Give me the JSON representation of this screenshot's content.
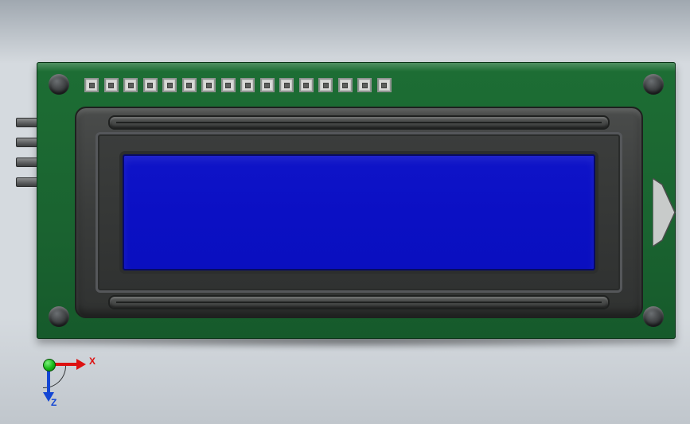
{
  "axes": {
    "x_label": "X",
    "z_label": "Z"
  },
  "model": {
    "pcb_color": "#1a6330",
    "screen_color": "#0b10c4",
    "pad_count": 16,
    "side_pin_count": 4
  }
}
